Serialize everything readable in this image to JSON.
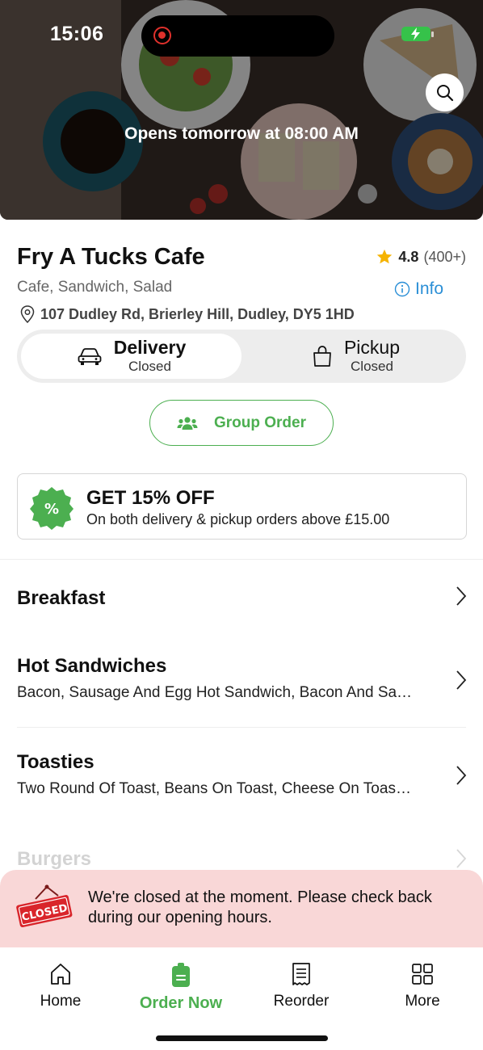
{
  "status_bar": {
    "time": "15:06"
  },
  "hero": {
    "message": "Opens tomorrow at 08:00 AM"
  },
  "shop": {
    "name": "Fry A Tucks Cafe",
    "rating": "4.8",
    "rating_count": "(400+)",
    "cuisine": "Cafe, Sandwich, Salad",
    "info_label": "Info",
    "address": "107 Dudley Rd, Brierley Hill, Dudley, DY5 1HD"
  },
  "order_mode": {
    "delivery": {
      "label": "Delivery",
      "status": "Closed",
      "selected": true
    },
    "pickup": {
      "label": "Pickup",
      "status": "Closed",
      "selected": false
    }
  },
  "group_order": {
    "label": "Group Order"
  },
  "promo": {
    "badge_symbol": "%",
    "title": "GET 15% OFF",
    "description": "On both delivery & pickup orders above £15.00"
  },
  "categories": [
    {
      "name": "Breakfast",
      "items": ""
    },
    {
      "name": "Hot Sandwiches",
      "items": "Bacon, Sausage And Egg Hot Sandwich, Bacon And Sa…"
    },
    {
      "name": "Toasties",
      "items": "Two Round Of Toast, Beans On Toast, Cheese On Toas…"
    },
    {
      "name": "Burgers",
      "items": ""
    }
  ],
  "closed_banner": {
    "sign_text": "CLOSED",
    "message": "We're closed at the moment. Please check back during our opening hours."
  },
  "bottom_nav": [
    {
      "label": "Home",
      "icon": "home-icon",
      "active": false
    },
    {
      "label": "Order Now",
      "icon": "order-bag-icon",
      "active": true
    },
    {
      "label": "Reorder",
      "icon": "receipt-icon",
      "active": false
    },
    {
      "label": "More",
      "icon": "grid-icon",
      "active": false
    }
  ],
  "colors": {
    "accent_green": "#4caf50",
    "info_blue": "#2b8fd6",
    "star_gold": "#f5b301",
    "closed_banner_bg": "#f9d7d7",
    "closed_sign_red": "#d9252b"
  }
}
